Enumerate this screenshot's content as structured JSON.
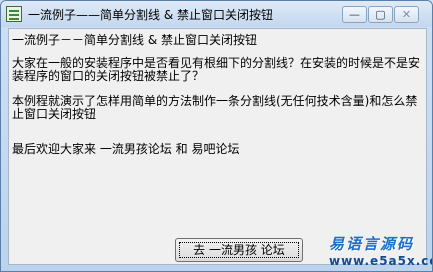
{
  "window": {
    "title": "一流例子——简单分割线 & 禁止窗口关闭按钮",
    "minimize_glyph": "—",
    "maximize_glyph": "▢",
    "close_glyph": "✕"
  },
  "content": {
    "heading": "一流例子－－简单分割线 & 禁止窗口关闭按钮",
    "para1": "大家在一般的安装程序中是否看见有根细下的分割线？在安装的时候是不是安装程序的窗口的关闭按钮被禁止了？",
    "para2": "本例程就演示了怎样用简单的方法制作一条分割线(无任何技术含量)和怎么禁止窗口关闭按钮",
    "para3": "最后欢迎大家来  一流男孩论坛  和  易吧论坛"
  },
  "button": {
    "label": "去 一流男孩 论坛"
  },
  "watermark": {
    "top": "易语言源码",
    "bottom": "www.e5a5x.com"
  }
}
